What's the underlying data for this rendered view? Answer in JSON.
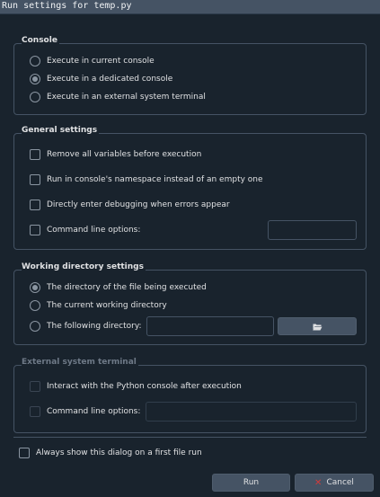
{
  "window": {
    "title": "Run settings for temp.py"
  },
  "console": {
    "title": "Console",
    "options": [
      {
        "label": "Execute in current console",
        "checked": false
      },
      {
        "label": "Execute in a dedicated console",
        "checked": true
      },
      {
        "label": "Execute in an external system terminal",
        "checked": false
      }
    ]
  },
  "general": {
    "title": "General settings",
    "options": [
      {
        "label": "Remove all variables before execution",
        "checked": false
      },
      {
        "label": "Run in console's namespace instead of an empty one",
        "checked": false
      },
      {
        "label": "Directly enter debugging when errors appear",
        "checked": false
      },
      {
        "label": "Command line options:",
        "checked": false
      }
    ],
    "cmdline_value": ""
  },
  "workdir": {
    "title": "Working directory settings",
    "options": [
      {
        "label": "The directory of the file being executed",
        "checked": true
      },
      {
        "label": "The current working directory",
        "checked": false
      },
      {
        "label": "The following directory:",
        "checked": false
      }
    ],
    "directory_value": "",
    "browse_icon": "folder-open-icon"
  },
  "external": {
    "title": "External system terminal",
    "options": [
      {
        "label": "Interact with the Python console after execution",
        "checked": false
      },
      {
        "label": "Command line options:",
        "checked": false
      }
    ],
    "cmdline_value": ""
  },
  "always_show": {
    "label": "Always show this dialog on a first file run",
    "checked": false
  },
  "buttons": {
    "run": "Run",
    "cancel": "Cancel"
  },
  "colors": {
    "background": "#19232d",
    "titlebar": "#455364",
    "border": "#455364",
    "text": "#e0e1e3",
    "disabled_text": "#6e7987",
    "cancel_icon": "#d13b3b"
  }
}
